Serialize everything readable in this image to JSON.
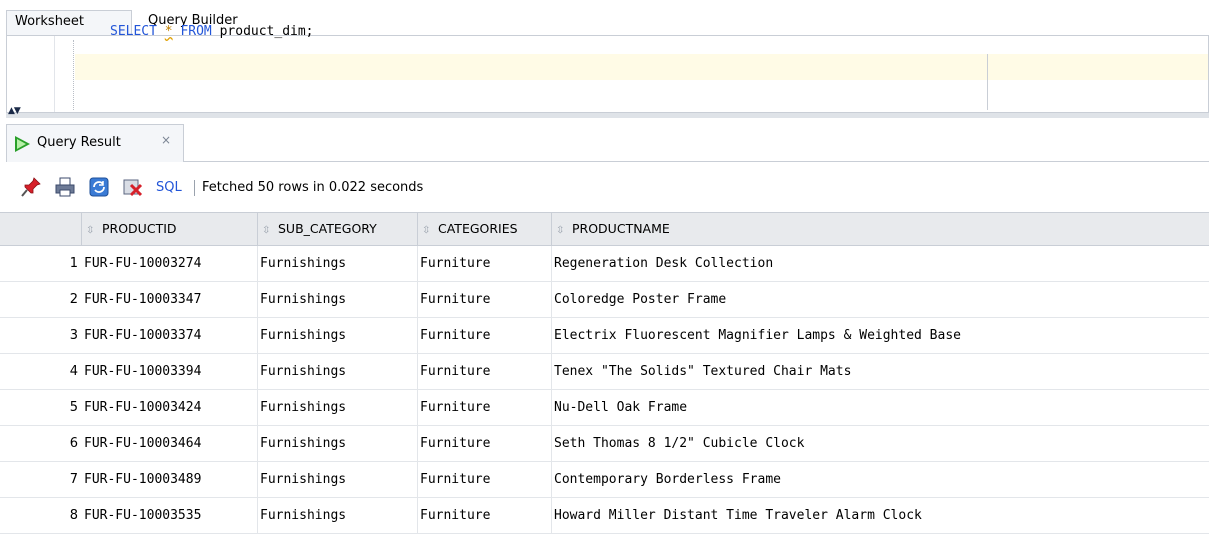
{
  "tabs": {
    "worksheet": "Worksheet",
    "query_builder": "Query Builder"
  },
  "editor": {
    "keyword_select": "SELECT",
    "star": "*",
    "keyword_from": "FROM",
    "table_rest": "product_dim;"
  },
  "result_tab": {
    "label": "Query Result",
    "close": "×"
  },
  "toolbar": {
    "sql_label": "SQL",
    "status": "Fetched 50 rows in 0.022 seconds"
  },
  "grid": {
    "columns": [
      "PRODUCTID",
      "SUB_CATEGORY",
      "CATEGORIES",
      "PRODUCTNAME"
    ],
    "rows": [
      {
        "n": "1",
        "id": "FUR-FU-10003274",
        "sub": "Furnishings",
        "cat": "Furniture",
        "name": "Regeneration Desk Collection"
      },
      {
        "n": "2",
        "id": "FUR-FU-10003347",
        "sub": "Furnishings",
        "cat": "Furniture",
        "name": "Coloredge Poster Frame"
      },
      {
        "n": "3",
        "id": "FUR-FU-10003374",
        "sub": "Furnishings",
        "cat": "Furniture",
        "name": "Electrix Fluorescent Magnifier Lamps & Weighted Base"
      },
      {
        "n": "4",
        "id": "FUR-FU-10003394",
        "sub": "Furnishings",
        "cat": "Furniture",
        "name": "Tenex \"The Solids\" Textured Chair Mats"
      },
      {
        "n": "5",
        "id": "FUR-FU-10003424",
        "sub": "Furnishings",
        "cat": "Furniture",
        "name": "Nu-Dell Oak Frame"
      },
      {
        "n": "6",
        "id": "FUR-FU-10003464",
        "sub": "Furnishings",
        "cat": "Furniture",
        "name": "Seth Thomas 8 1/2\" Cubicle Clock"
      },
      {
        "n": "7",
        "id": "FUR-FU-10003489",
        "sub": "Furnishings",
        "cat": "Furniture",
        "name": "Contemporary Borderless Frame"
      },
      {
        "n": "8",
        "id": "FUR-FU-10003535",
        "sub": "Furnishings",
        "cat": "Furniture",
        "name": "Howard Miller Distant Time Traveler Alarm Clock"
      }
    ]
  },
  "colors": {
    "keyword": "#2255d8",
    "current_line": "#fffbe6",
    "header_bg": "#e8eaed"
  }
}
